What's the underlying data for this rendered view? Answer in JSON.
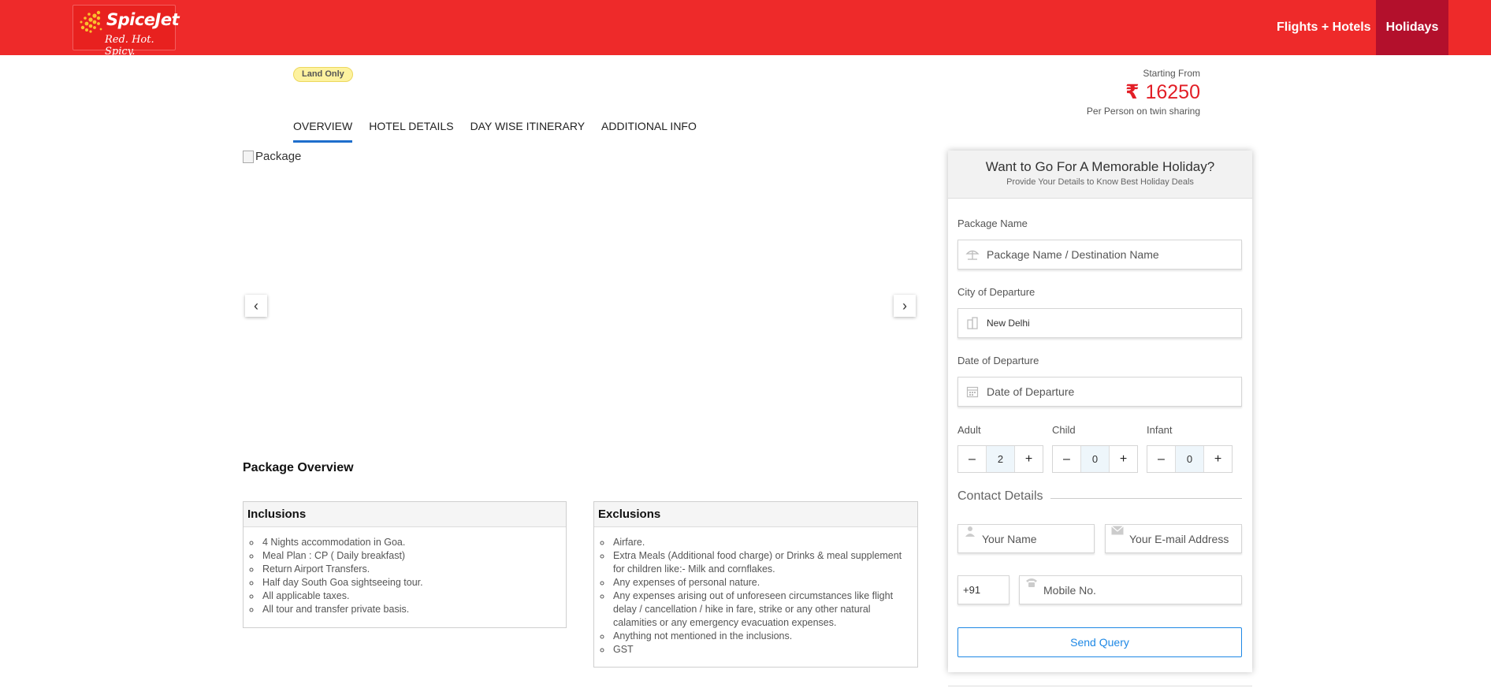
{
  "header": {
    "logo_brand": "SpiceJet",
    "logo_tagline": "Red. Hot. Spicy.",
    "nav": [
      {
        "label": "Flights + Hotels"
      },
      {
        "label": "Holidays"
      }
    ],
    "brand_color": "#ee2a2a"
  },
  "package": {
    "badge": "Land Only",
    "starting_from": "Starting From",
    "currency_symbol": "₹",
    "price": "16250",
    "price_note": "Per Person on twin sharing",
    "image_alt": "Package"
  },
  "tabs": [
    {
      "label": "OVERVIEW",
      "active": true
    },
    {
      "label": "HOTEL DETAILS"
    },
    {
      "label": "DAY WISE ITINERARY"
    },
    {
      "label": "ADDITIONAL INFO"
    }
  ],
  "overview": {
    "title": "Package Overview",
    "inclusions_title": "Inclusions",
    "inclusions": [
      "4 Nights accommodation in Goa.",
      "Meal Plan : CP ( Daily breakfast)",
      "Return Airport Transfers.",
      "Half day South Goa sightseeing tour.",
      "All applicable taxes.",
      "All tour and transfer private basis."
    ],
    "exclusions_title": "Exclusions",
    "exclusions": [
      "Airfare.",
      "Extra Meals (Additional food charge) or Drinks & meal supplement for children like:- Milk and cornflakes.",
      "Any expenses of personal nature.",
      "Any expenses arising out of unforeseen circumstances like flight delay / cancellation / hike in fare, strike or any other natural calamities or any emergency evacuation expenses.",
      "Anything not mentioned in the inclusions.",
      "GST"
    ]
  },
  "form": {
    "title": "Want to Go For A Memorable Holiday?",
    "subtitle": "Provide Your Details to Know Best Holiday Deals",
    "package_label": "Package Name",
    "package_placeholder": "Package Name / Destination Name",
    "city_label": "City of Departure",
    "city_value": "New Delhi",
    "date_label": "Date of Departure",
    "date_placeholder": "Date of Departure",
    "adult_label": "Adult",
    "adult_value": "2",
    "child_label": "Child",
    "child_value": "0",
    "infant_label": "Infant",
    "infant_value": "0",
    "minus": "–",
    "plus": "+",
    "contact_title": "Contact Details",
    "name_placeholder": "Your Name",
    "email_placeholder": "Your E-mail Address",
    "country_code": "+91",
    "mobile_placeholder": "Mobile No.",
    "send_label": "Send Query"
  }
}
